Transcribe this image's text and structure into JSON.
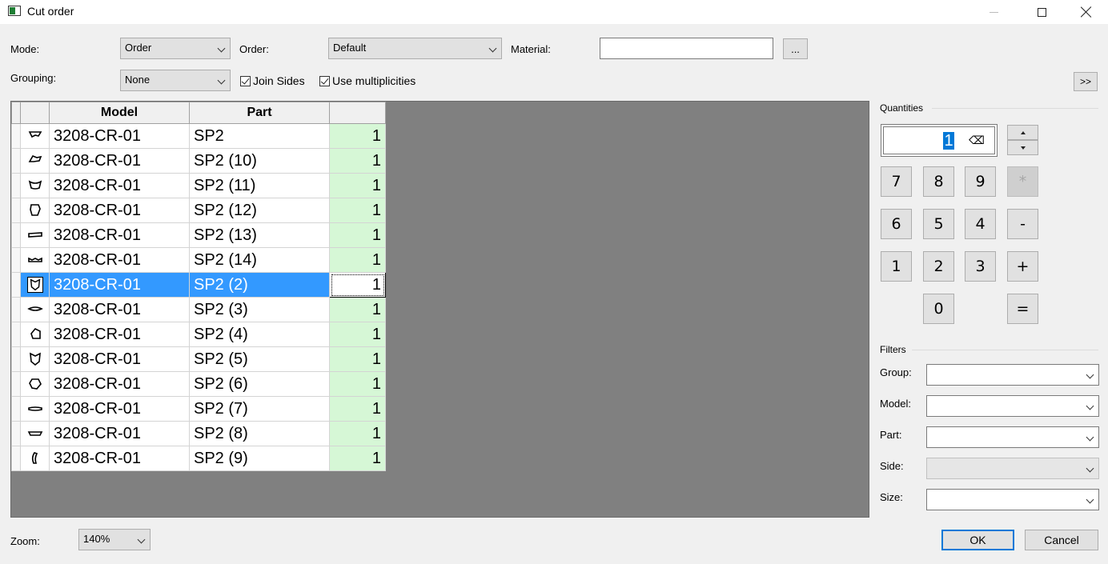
{
  "window": {
    "title": "Cut order"
  },
  "toolbar": {
    "mode_label": "Mode:",
    "mode_value": "Order",
    "order_label": "Order:",
    "order_value": "Default",
    "material_label": "Material:",
    "material_value": "",
    "browse_label": "...",
    "grouping_label": "Grouping:",
    "grouping_value": "None",
    "join_sides_label": "Join Sides",
    "join_sides_checked": true,
    "use_multiplicities_label": "Use multiplicities",
    "use_multiplicities_checked": true,
    "expand_label": ">>"
  },
  "grid": {
    "columns": [
      "Model",
      "Part",
      ""
    ],
    "selected_index": 6,
    "rows": [
      {
        "icon": "part-shape-icon",
        "model": "3208-CR-01",
        "part": "SP2",
        "qty": "1"
      },
      {
        "icon": "part-shape-icon",
        "model": "3208-CR-01",
        "part": "SP2 (10)",
        "qty": "1"
      },
      {
        "icon": "part-shape-icon",
        "model": "3208-CR-01",
        "part": "SP2 (11)",
        "qty": "1"
      },
      {
        "icon": "part-shape-icon",
        "model": "3208-CR-01",
        "part": "SP2 (12)",
        "qty": "1"
      },
      {
        "icon": "part-shape-icon",
        "model": "3208-CR-01",
        "part": "SP2 (13)",
        "qty": "1"
      },
      {
        "icon": "part-shape-icon",
        "model": "3208-CR-01",
        "part": "SP2 (14)",
        "qty": "1"
      },
      {
        "icon": "part-shape-icon",
        "model": "3208-CR-01",
        "part": "SP2 (2)",
        "qty": "1"
      },
      {
        "icon": "part-shape-icon",
        "model": "3208-CR-01",
        "part": "SP2 (3)",
        "qty": "1"
      },
      {
        "icon": "part-shape-icon",
        "model": "3208-CR-01",
        "part": "SP2 (4)",
        "qty": "1"
      },
      {
        "icon": "part-shape-icon",
        "model": "3208-CR-01",
        "part": "SP2 (5)",
        "qty": "1"
      },
      {
        "icon": "part-shape-icon",
        "model": "3208-CR-01",
        "part": "SP2 (6)",
        "qty": "1"
      },
      {
        "icon": "part-shape-icon",
        "model": "3208-CR-01",
        "part": "SP2 (7)",
        "qty": "1"
      },
      {
        "icon": "part-shape-icon",
        "model": "3208-CR-01",
        "part": "SP2 (8)",
        "qty": "1"
      },
      {
        "icon": "part-shape-icon",
        "model": "3208-CR-01",
        "part": "SP2 (9)",
        "qty": "1"
      }
    ]
  },
  "quantities": {
    "title": "Quantities",
    "value": "1",
    "backspace_label": "⌫",
    "keys": {
      "k7": "7",
      "k8": "8",
      "k9": "9",
      "mul": "*",
      "k6": "6",
      "k5": "5",
      "k4": "4",
      "minus": "-",
      "k1": "1",
      "k2": "2",
      "k3": "3",
      "plus": "+",
      "k0": "0",
      "equals": "="
    }
  },
  "filters": {
    "title": "Filters",
    "group_label": "Group:",
    "model_label": "Model:",
    "part_label": "Part:",
    "side_label": "Side:",
    "size_label": "Size:"
  },
  "footer": {
    "zoom_label": "Zoom:",
    "zoom_value": "140%",
    "ok_label": "OK",
    "cancel_label": "Cancel"
  },
  "colors": {
    "selection": "#3399ff",
    "qty_cell": "#d6f7d6",
    "grid_background": "#808080",
    "accent": "#0078d7"
  }
}
